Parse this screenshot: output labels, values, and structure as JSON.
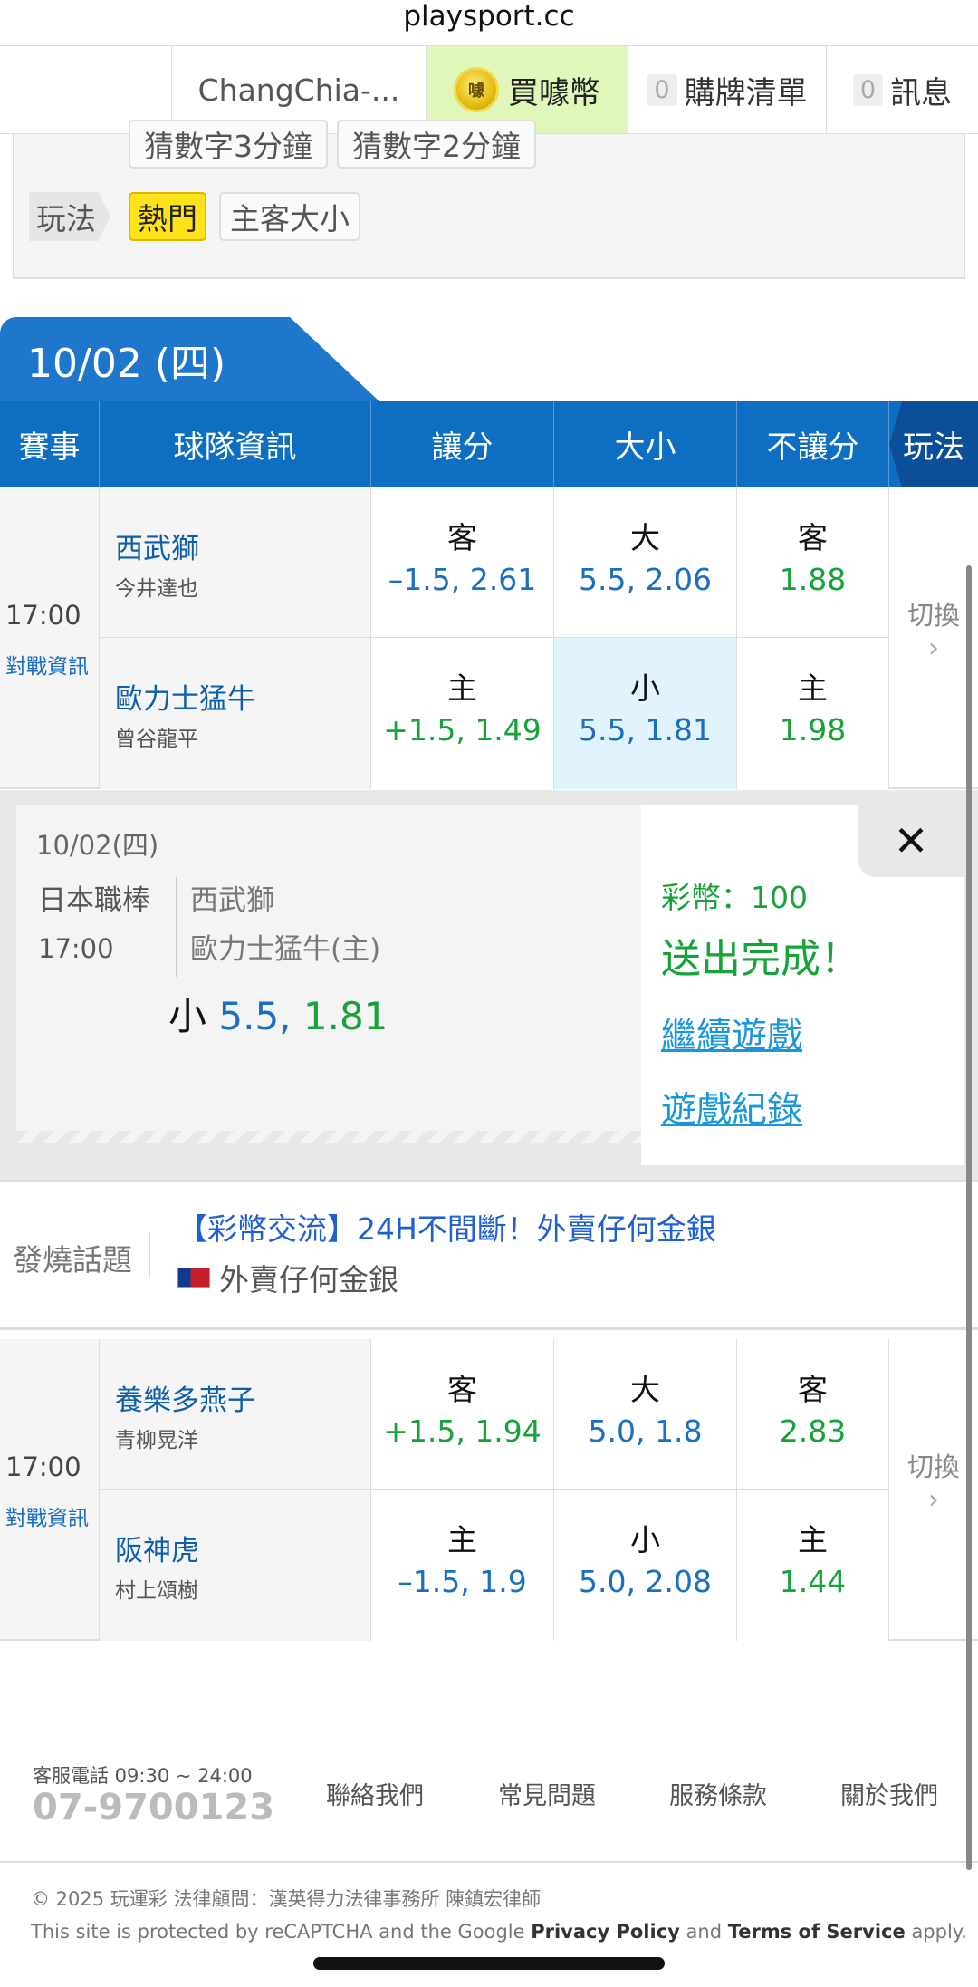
{
  "browser": {
    "url": "playsport.cc"
  },
  "nav": {
    "username": "ChangChia-...",
    "buy_label": "買噱幣",
    "coin_char": "噱",
    "cart_count": "0",
    "cart_label": "購牌清單",
    "msg_count": "0",
    "msg_label": "訊息"
  },
  "filters": {
    "cut_chips": [
      "猜數字3分鐘",
      "猜數字2分鐘"
    ],
    "play_label": "玩法",
    "hot": "熱門",
    "home_away": "主客大小"
  },
  "date_tab": "10/02 (四)",
  "table_headers": [
    "賽事",
    "球隊資訊",
    "讓分",
    "大小",
    "不讓分",
    "玩法"
  ],
  "games": [
    {
      "time": "17:00",
      "vs_link": "對戰資訊",
      "switch": "切換",
      "away": {
        "team": "西武獅",
        "pitcher": "今井達也",
        "spread_k": "客",
        "spread": "–1.5, 2.61",
        "total_k": "大",
        "total": "5.5, 2.06",
        "ml_k": "客",
        "ml": "1.88"
      },
      "home": {
        "team": "歐力士猛牛",
        "pitcher": "曾谷龍平",
        "spread_k": "主",
        "spread": "+1.5, 1.49",
        "total_k": "小",
        "total": "5.5, 1.81",
        "ml_k": "主",
        "ml": "1.98"
      }
    },
    {
      "time": "17:00",
      "vs_link": "對戰資訊",
      "switch": "切換",
      "away": {
        "team": "養樂多燕子",
        "pitcher": "青柳晃洋",
        "spread_k": "客",
        "spread": "+1.5, 1.94",
        "total_k": "大",
        "total": "5.0, 1.8",
        "ml_k": "客",
        "ml": "2.83"
      },
      "home": {
        "team": "阪神虎",
        "pitcher": "村上頌樹",
        "spread_k": "主",
        "spread": "–1.5, 1.9",
        "total_k": "小",
        "total": "5.0, 2.08",
        "ml_k": "主",
        "ml": "1.44"
      }
    }
  ],
  "bet_ticket": {
    "date": "10/02(四)",
    "league": "日本職棒",
    "time": "17:00",
    "team1": "西武獅",
    "team2": "歐力士猛牛(主)",
    "pick_label": "小",
    "pick_line": "5.5,",
    "pick_odds": "1.81",
    "coins": "彩幣：100",
    "done": "送出完成！",
    "continue": "繼續遊戲",
    "record": "遊戲紀錄",
    "close": "✕"
  },
  "hot_topic": {
    "label": "發燒話題",
    "title": "【彩幣交流】24H不間斷！外賣仔何金銀",
    "author": "外賣仔何金銀"
  },
  "footer": {
    "service": "客服電話 09:30 ~ 24:00",
    "phone": "07-9700123",
    "links": [
      "聯絡我們",
      "常見問題",
      "服務條款",
      "關於我們"
    ],
    "copyright": "© 2025 玩運彩 法律顧問：漢英得力法律事務所 陳鎮宏律師",
    "recaptcha_pre": "This site is protected by reCAPTCHA and the Google",
    "privacy": "Privacy Policy",
    "and": "and",
    "terms": "Terms of Service",
    "apply": "apply."
  }
}
